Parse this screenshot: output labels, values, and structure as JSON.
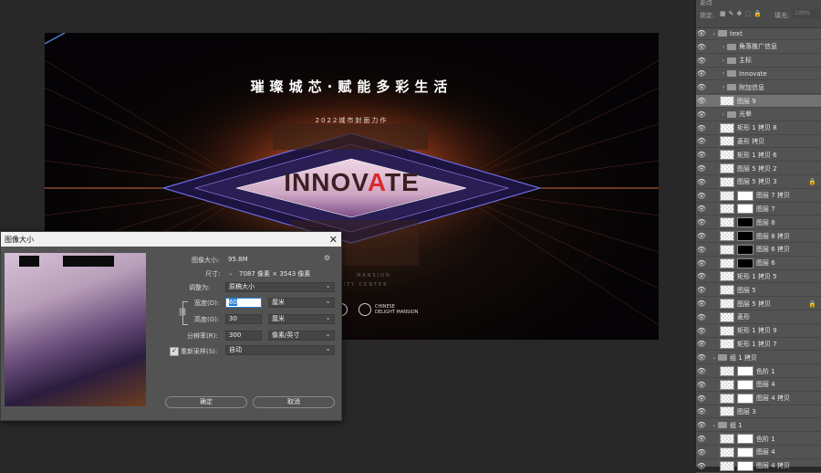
{
  "artwork": {
    "headline": "璀璨城芯·赋能多彩生活",
    "subline": "2022城市封面力作",
    "logo_main": "INNOV",
    "logo_accent": "A",
    "logo_end": "TE",
    "faint_mansion": "MANSION",
    "faint_center": "CITY CENTER",
    "brand_logo_line1": "CHINESE",
    "brand_logo_line2": "DELIGHT MANSION"
  },
  "dialog": {
    "title": "图像大小",
    "image_size_label": "图像大小:",
    "image_size_value": "95.8M",
    "dimensions_label": "尺寸:",
    "dimensions_value": "7087 像素 × 3543 像素",
    "fit_to_label": "调整为:",
    "fit_to_value": "原稿大小",
    "width_label": "宽度(D):",
    "width_value": "60",
    "width_unit": "厘米",
    "height_label": "高度(G):",
    "height_value": "30",
    "height_unit": "厘米",
    "resolution_label": "分辨率(R):",
    "resolution_value": "300",
    "resolution_unit": "像素/英寸",
    "resample_label": "重新采样(S):",
    "resample_checked": true,
    "resample_value": "自动",
    "ok_label": "确定",
    "cancel_label": "取消"
  },
  "layers": {
    "top_text": "更改",
    "lock_label": "锁定:",
    "fill_label": "填充:",
    "fill_value": "100%",
    "items": [
      {
        "name": "text",
        "type": "group",
        "expanded": true
      },
      {
        "name": "角落推广信息",
        "type": "group"
      },
      {
        "name": "主标",
        "type": "group"
      },
      {
        "name": "Innovate",
        "type": "group"
      },
      {
        "name": "附加信息",
        "type": "group"
      },
      {
        "name": "图层 9",
        "type": "layer",
        "selected": true
      },
      {
        "name": "光晕",
        "type": "group"
      },
      {
        "name": "矩形 1 拷贝 8",
        "type": "layer"
      },
      {
        "name": "菱形 拷贝",
        "type": "layer"
      },
      {
        "name": "矩形 1 拷贝 6",
        "type": "layer"
      },
      {
        "name": "图层 5 拷贝 2",
        "type": "layer"
      },
      {
        "name": "图层 5 拷贝 3",
        "type": "layer",
        "locked": true
      },
      {
        "name": "图层 7 拷贝",
        "type": "layer"
      },
      {
        "name": "图层 7",
        "type": "layer"
      },
      {
        "name": "图层 8",
        "type": "layer"
      },
      {
        "name": "图层 8 拷贝",
        "type": "layer"
      },
      {
        "name": "图层 6 拷贝",
        "type": "layer"
      },
      {
        "name": "图层 6",
        "type": "layer"
      },
      {
        "name": "矩形 1 拷贝 5",
        "type": "layer"
      },
      {
        "name": "图层 5",
        "type": "layer"
      },
      {
        "name": "图层 5 拷贝",
        "type": "layer",
        "locked": true
      },
      {
        "name": "菱形",
        "type": "layer"
      },
      {
        "name": "矩形 1 拷贝 9",
        "type": "layer"
      },
      {
        "name": "矩形 1 拷贝 7",
        "type": "layer"
      },
      {
        "name": "组 1 拷贝",
        "type": "group",
        "expanded": true
      },
      {
        "name": "色阶 1",
        "type": "adjustment"
      },
      {
        "name": "图层 4",
        "type": "layer"
      },
      {
        "name": "图层 4 拷贝",
        "type": "layer"
      },
      {
        "name": "图层 3",
        "type": "layer"
      },
      {
        "name": "组 1",
        "type": "group",
        "expanded": true
      },
      {
        "name": "色阶 1",
        "type": "adjustment"
      },
      {
        "name": "图层 4",
        "type": "layer"
      },
      {
        "name": "图层 4 拷贝",
        "type": "layer"
      }
    ]
  }
}
